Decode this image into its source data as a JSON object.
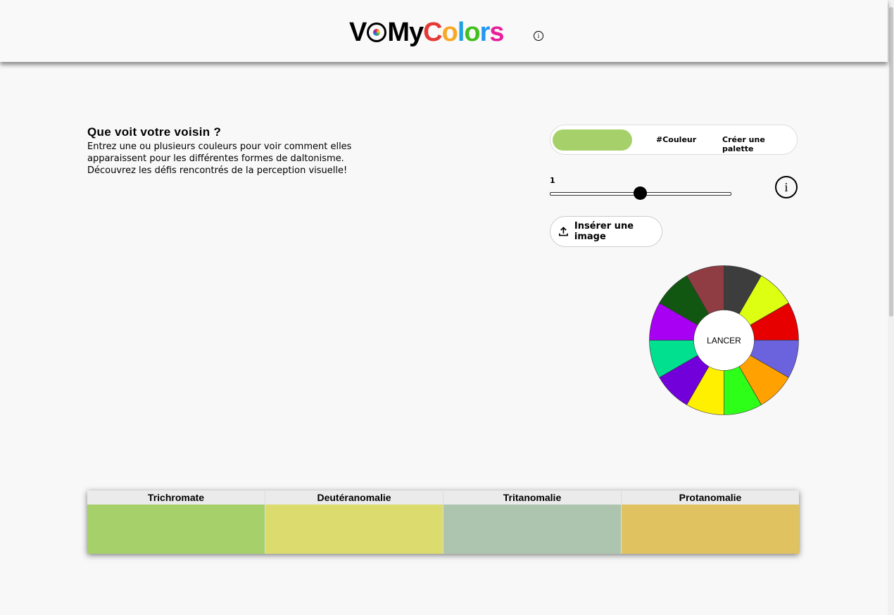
{
  "header": {
    "logo": {
      "part1": "V",
      "part2": "MyColors",
      "letters": [
        "C",
        "o",
        "l",
        "o",
        "r",
        "s"
      ],
      "letter_colors": [
        "#e53935",
        "#f9a825",
        "#1fa0e0",
        "#43c01f",
        "#2196f3",
        "#e91e9b"
      ]
    },
    "info_icon": "i"
  },
  "intro": {
    "title": "Que voit votre voisin ?",
    "lines": [
      "Entrez une ou plusieurs couleurs pour voir comment elles",
      "apparaissent pour les différentes formes de daltonisme.",
      "Découvrez les défis rencontrés de la perception visuelle!"
    ]
  },
  "tabs": {
    "swatch_color": "#a6d16a",
    "couleur_label": "#Couleur",
    "palette_label": "Créer une palette"
  },
  "slider": {
    "value_label": "1",
    "value": 0.5
  },
  "info_icon": "i",
  "upload": {
    "label": "Insérer une image"
  },
  "wheel": {
    "center_label": "LANCER",
    "segments": [
      "#3d3d3d",
      "#ddff12",
      "#e60000",
      "#6b63de",
      "#ffa100",
      "#2dff18",
      "#fff000",
      "#7100db",
      "#00e08f",
      "#a700f2",
      "#115712",
      "#8f3d43"
    ]
  },
  "results": [
    {
      "label": "Trichromate",
      "color": "#a6d16a"
    },
    {
      "label": "Deutéranomalie",
      "color": "#dbdb6e"
    },
    {
      "label": "Tritanomalie",
      "color": "#adc5af"
    },
    {
      "label": "Protanomalie",
      "color": "#e1c261"
    }
  ]
}
